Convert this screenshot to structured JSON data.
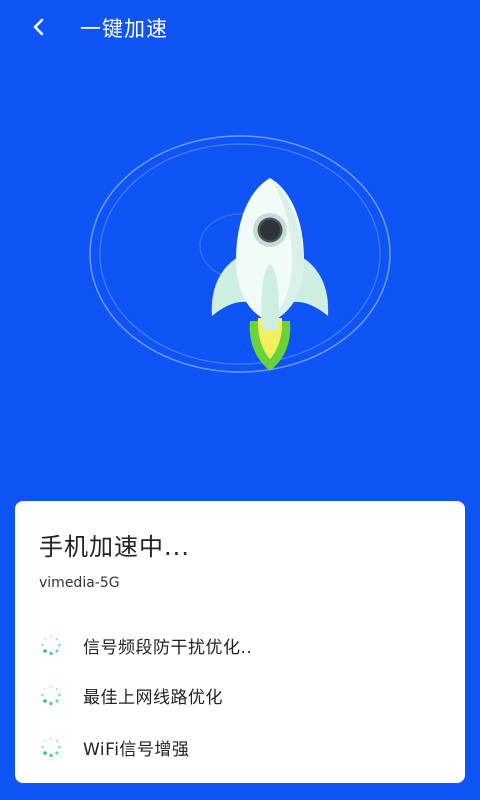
{
  "header": {
    "title": "一键加速"
  },
  "card": {
    "title": "手机加速中...",
    "network": "vimedia-5G",
    "tasks": [
      {
        "label": "信号频段防干扰优化.."
      },
      {
        "label": "最佳上网线路优化"
      },
      {
        "label": "WiFi信号增强"
      }
    ]
  },
  "colors": {
    "background": "#0f55f6",
    "card": "#ffffff",
    "spinner": "#1fc37a",
    "flame_outer": "#6bd23a",
    "flame_inner": "#f3f15b"
  },
  "icons": {
    "back": "back-arrow-icon",
    "rocket": "rocket-illustration",
    "spinner": "loading-spinner-icon"
  }
}
